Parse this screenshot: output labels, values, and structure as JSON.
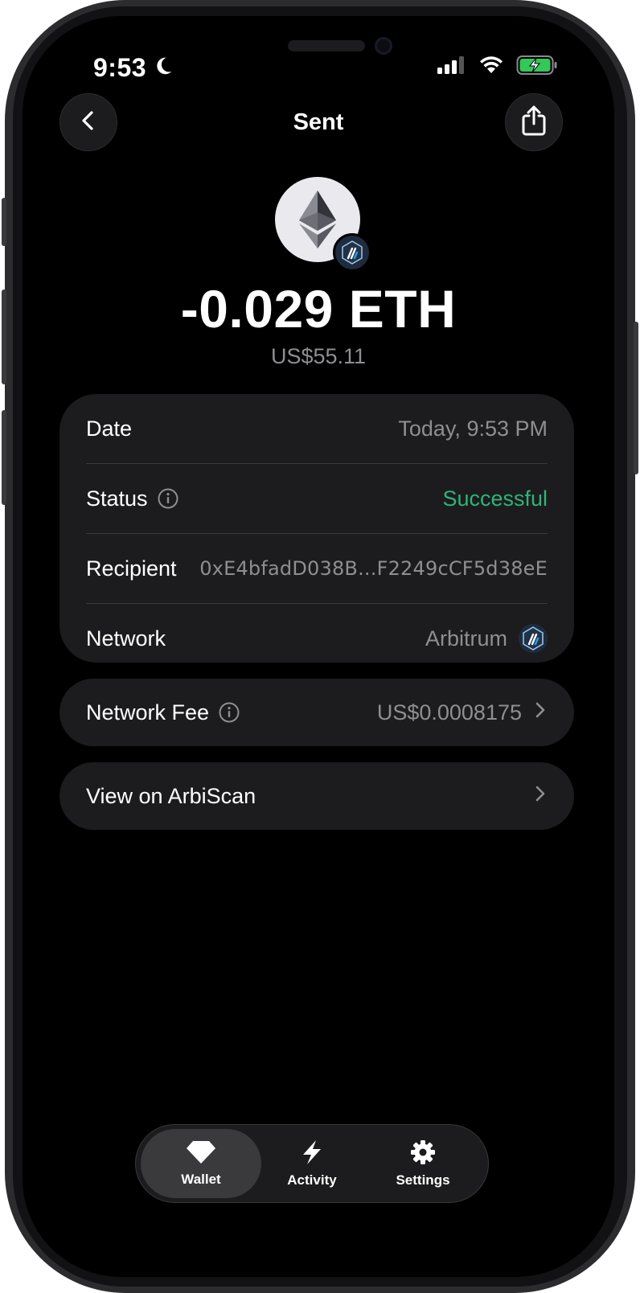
{
  "status_bar": {
    "time": "9:53"
  },
  "nav": {
    "title": "Sent"
  },
  "transaction": {
    "amount": "-0.029 ETH",
    "fiat_value": "US$55.11"
  },
  "details": {
    "date": {
      "label": "Date",
      "value": "Today, 9:53 PM"
    },
    "status": {
      "label": "Status",
      "value": "Successful"
    },
    "recipient": {
      "label": "Recipient",
      "value": "0xE4bfadD038B...F2249cCF5d38eE"
    },
    "network": {
      "label": "Network",
      "value": "Arbitrum"
    }
  },
  "fee": {
    "label": "Network Fee",
    "value": "US$0.0008175"
  },
  "explorer": {
    "label": "View on ArbiScan"
  },
  "tabbar": {
    "tabs": [
      {
        "label": "Wallet",
        "icon": "gem-icon",
        "active": true
      },
      {
        "label": "Activity",
        "icon": "bolt-icon",
        "active": false
      },
      {
        "label": "Settings",
        "icon": "gear-icon",
        "active": false
      }
    ]
  },
  "colors": {
    "background": "#000000",
    "card": "#1c1c1e",
    "success": "#2fb37a",
    "secondary_text": "#8e8e93"
  }
}
